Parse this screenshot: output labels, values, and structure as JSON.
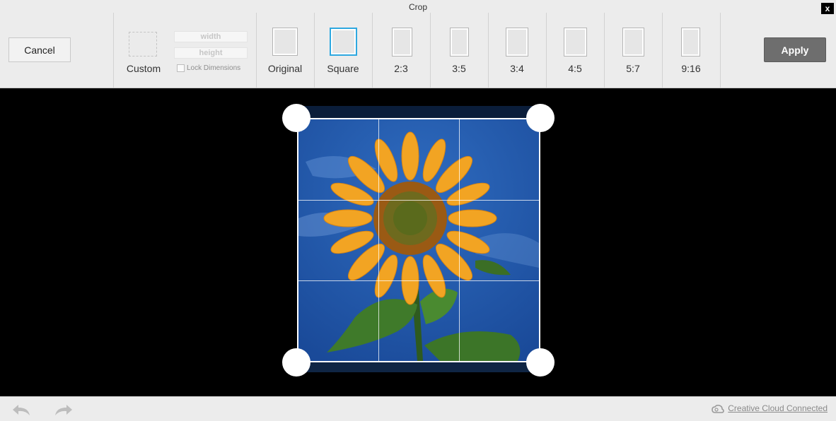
{
  "window": {
    "title": "Crop",
    "close_label": "x"
  },
  "toolbar": {
    "cancel_label": "Cancel",
    "apply_label": "Apply",
    "custom": {
      "label": "Custom",
      "width_placeholder": "width",
      "height_placeholder": "height",
      "lock_label": "Lock Dimensions",
      "lock_checked": false
    },
    "ratios": [
      {
        "label": "Original",
        "selected": false
      },
      {
        "label": "Square",
        "selected": true
      },
      {
        "label": "2:3",
        "selected": false
      },
      {
        "label": "3:5",
        "selected": false
      },
      {
        "label": "3:4",
        "selected": false
      },
      {
        "label": "4:5",
        "selected": false
      },
      {
        "label": "5:7",
        "selected": false
      },
      {
        "label": "9:16",
        "selected": false
      }
    ]
  },
  "canvas": {
    "image_subject": "sunflower against blue sky",
    "grid": "rule-of-thirds"
  },
  "footer": {
    "undo_icon": "undo-arrow-icon",
    "redo_icon": "redo-arrow-icon",
    "status_label": "Creative Cloud Connected",
    "status_icon": "creative-cloud-icon"
  },
  "colors": {
    "selected_accent": "#2ea8e0",
    "apply_bg": "#6e6e6e",
    "workspace_bg": "#000000"
  }
}
